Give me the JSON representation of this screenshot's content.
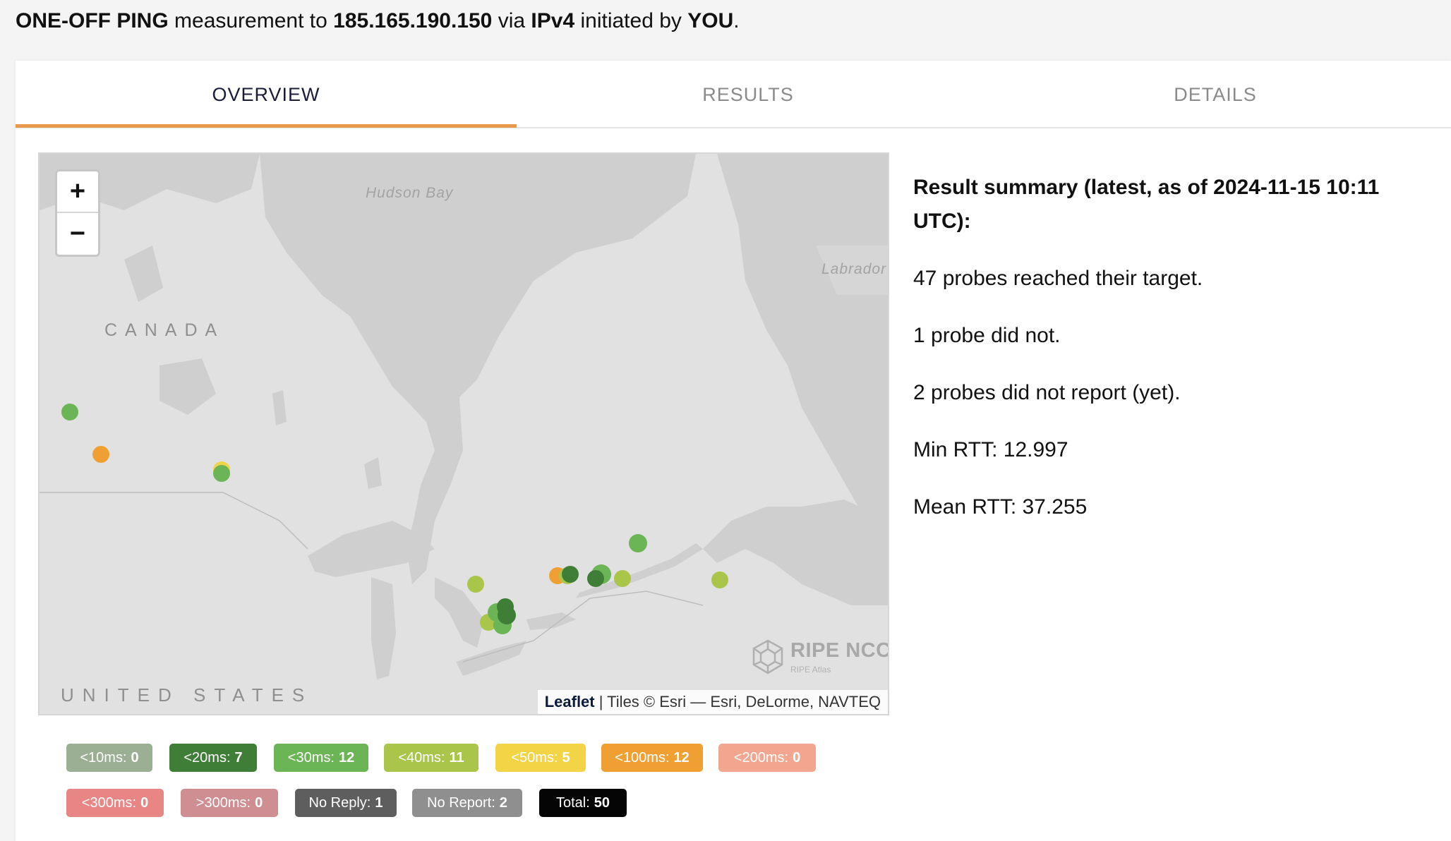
{
  "header": {
    "type": "ONE-OFF PING",
    "text1": "measurement to",
    "target": "185.165.190.150",
    "text2": "via",
    "protocol": "IPv4",
    "text3": "initiated by",
    "initiator": "YOU",
    "period": "."
  },
  "tabs": [
    {
      "label": "OVERVIEW",
      "active": true
    },
    {
      "label": "RESULTS",
      "active": false
    },
    {
      "label": "DETAILS",
      "active": false
    }
  ],
  "map": {
    "zoom_in": "+",
    "zoom_out": "−",
    "labels": {
      "canada": "CANADA",
      "united_states": "UNITED STATES",
      "hudson_bay": "Hudson Bay",
      "labrador": "Labrador"
    },
    "watermark": {
      "name": "RIPE NCC",
      "sub": "RIPE Atlas"
    },
    "attribution": {
      "leaflet": "Leaflet",
      "rest": " | Tiles © Esri — Esri, DeLorme, NAVTEQ"
    }
  },
  "summary": {
    "title": "Result summary (latest, as of 2024-11-15 10:11 UTC):",
    "reached": "47 probes reached their target.",
    "not_reached": "1 probe did not.",
    "not_reported": "2 probes did not report (yet).",
    "min_rtt": "Min RTT: 12.997",
    "mean_rtt": "Mean RTT: 37.255"
  },
  "legend": [
    {
      "label": "<10ms:",
      "count": "0",
      "color": "#9aaf94"
    },
    {
      "label": "<20ms:",
      "count": "7",
      "color": "#3f7e37"
    },
    {
      "label": "<30ms:",
      "count": "12",
      "color": "#6bb556"
    },
    {
      "label": "<40ms:",
      "count": "11",
      "color": "#a9c64a"
    },
    {
      "label": "<50ms:",
      "count": "5",
      "color": "#f3d446"
    },
    {
      "label": "<100ms:",
      "count": "12",
      "color": "#f0a033"
    },
    {
      "label": "<200ms:",
      "count": "0",
      "color": "#f2a68f"
    },
    {
      "label": "<300ms:",
      "count": "0",
      "color": "#e88585"
    },
    {
      "label": ">300ms:",
      "count": "0",
      "color": "#cf8e92"
    },
    {
      "label": "No Reply:",
      "count": "1",
      "color": "#5e5e5e"
    },
    {
      "label": "No Report:",
      "count": "2",
      "color": "#8f8f8f"
    },
    {
      "label": "Total:",
      "count": "50",
      "color": "#050505"
    }
  ],
  "colors": {
    "tab_accent": "#e8994a",
    "land": "#e1e1e1",
    "water": "#cfcfcf"
  }
}
